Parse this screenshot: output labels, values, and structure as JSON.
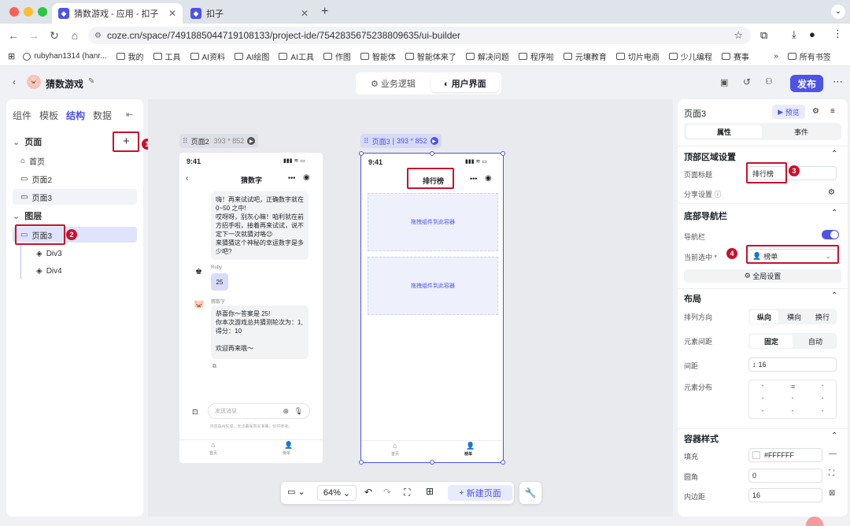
{
  "browser": {
    "tabs": [
      {
        "title": "猜数游戏 - 应用 - 扣子"
      },
      {
        "title": "扣子"
      }
    ],
    "url": "coze.cn/space/7491885044719108133/project-ide/7542835675238809635/ui-builder",
    "bookmarks": [
      "rubyhan1314 (hanr...",
      "我的",
      "工具",
      "AI资料",
      "AI绘图",
      "AI工具",
      "作图",
      "智能体",
      "智能体来了",
      "解决问题",
      "程序啦",
      "元壤教育",
      "切片电商",
      "少儿编程",
      "赛事"
    ],
    "bookmarks_more": "»",
    "all_bookmarks": "所有书签"
  },
  "app": {
    "title": "猜数游戏",
    "mode_tabs": [
      {
        "label": "业务逻辑",
        "active": false
      },
      {
        "label": "用户界面",
        "active": true
      }
    ],
    "publish_label": "发布"
  },
  "left_panel": {
    "tabs": [
      "组件",
      "模板",
      "结构",
      "数据"
    ],
    "active_tab": "结构",
    "pages_section": "页面",
    "pages": [
      "首页",
      "页面2",
      "页面3"
    ],
    "layers_section": "图层",
    "layers": [
      "页面3",
      "Div3",
      "Div4"
    ]
  },
  "canvas": {
    "page2": {
      "label": "页面2",
      "size": "393 * 852",
      "status_time": "9:41",
      "title": "猜数字",
      "bot_msg_1": "嗨！再来试试吧，正确数字就在0~50 之中!\n哎呀呀，别灰心嘛！咱利就在前方招手啦，接着再来试试，说不定下一次就猜对咯😉\n来猜猜这个神秘的幸运数字是多少吧?",
      "user_name": "Ruby",
      "user_msg": "25",
      "bot_name": "猜数字",
      "bot_msg_2": "恭喜你～答案是 25!\n你本次游戏总共猜测轮次为：1,\n得分：10\n\n欢迎再来哦～",
      "input_placeholder": "发送消息",
      "disclaimer": "内容由AI生成，无法确保真实准确，仅供参考。",
      "nav": [
        "首页",
        "榜单"
      ]
    },
    "page3": {
      "label": "页面3",
      "size": "393 * 852",
      "status_time": "9:41",
      "title": "排行榜",
      "drop_hint_1": "拖拽组件到此容器",
      "drop_hint_2": "拖拽组件到此容器",
      "nav": [
        "首页",
        "榜单"
      ]
    },
    "zoom": "64%",
    "new_page": "新建页面"
  },
  "right_panel": {
    "page_name": "页面3",
    "preview": "预览",
    "tabs": [
      "属性",
      "事件"
    ],
    "active_tab": "属性",
    "top_section": "顶部区域设置",
    "page_title_label": "页面标题",
    "page_title_value": "排行榜",
    "share_label": "分享设置",
    "bottom_nav_section": "底部导航栏",
    "nav_bar_label": "导航栏",
    "nav_bar_on": true,
    "current_selected_label": "当前选中",
    "current_selected_value": "榜单",
    "global_settings": "全局设置",
    "layout_section": "布局",
    "direction_label": "排列方向",
    "direction_options": [
      "纵向",
      "横向",
      "换行"
    ],
    "direction_active": "纵向",
    "spacing_mode_label": "元素间距",
    "spacing_mode_options": [
      "固定",
      "自动"
    ],
    "spacing_mode_active": "固定",
    "gap_label": "间距",
    "gap_value": "16",
    "distribution_label": "元素分布",
    "container_style_section": "容器样式",
    "fill_label": "填充",
    "fill_value": "#FFFFFF",
    "radius_label": "圆角",
    "radius_value": "0",
    "padding_label": "内边距",
    "padding_value": "16"
  },
  "annotations": [
    "1",
    "2",
    "3",
    "4"
  ],
  "colors": {
    "accent": "#4d53e8",
    "annotation": "#c8102e"
  }
}
